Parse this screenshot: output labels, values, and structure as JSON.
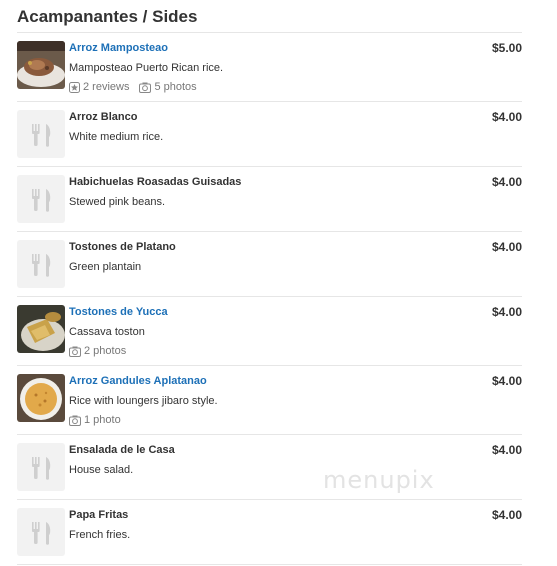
{
  "section": {
    "title": "Acampanantes / Sides"
  },
  "items": [
    {
      "name": "Arroz Mamposteao",
      "description": "Mamposteao Puerto Rican rice.",
      "price": "$5.00",
      "reviews": "2 reviews",
      "photos": "5 photos",
      "has_photo": true
    },
    {
      "name": "Arroz Blanco",
      "description": "White medium rice.",
      "price": "$4.00",
      "has_photo": false
    },
    {
      "name": "Habichuelas Roasadas Guisadas",
      "description": "Stewed pink beans.",
      "price": "$4.00",
      "has_photo": false
    },
    {
      "name": "Tostones de Platano",
      "description": "Green plantain",
      "price": "$4.00",
      "has_photo": false
    },
    {
      "name": "Tostones de Yucca",
      "description": "Cassava toston",
      "price": "$4.00",
      "photos": "2 photos",
      "has_photo": true
    },
    {
      "name": "Arroz Gandules Aplatanao",
      "description": "Rice with loungers jibaro style.",
      "price": "$4.00",
      "photos": "1 photo",
      "has_photo": true
    },
    {
      "name": "Ensalada de le Casa",
      "description": "House salad.",
      "price": "$4.00",
      "has_photo": false
    },
    {
      "name": "Papa Fritas",
      "description": "French fries.",
      "price": "$4.00",
      "has_photo": false
    }
  ],
  "watermark": "menupix",
  "colors": {
    "link": "#1d70b7",
    "text": "#333333",
    "muted": "#777777",
    "divider": "#e6e6e6",
    "placeholder_bg": "#f2f2f2"
  }
}
